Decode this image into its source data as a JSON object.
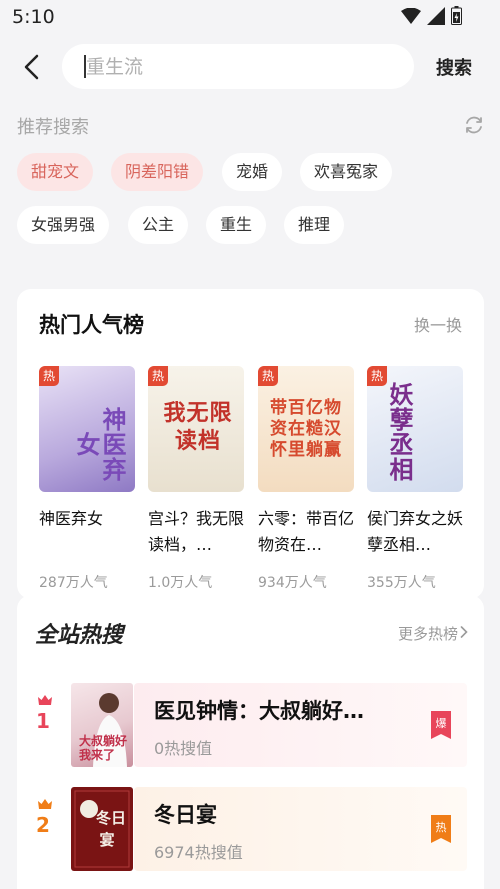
{
  "status": {
    "time": "5:10"
  },
  "search": {
    "placeholder": "重生流",
    "button": "搜索"
  },
  "recommend": {
    "title": "推荐搜索",
    "tags": [
      {
        "label": "甜宠文",
        "hot": true
      },
      {
        "label": "阴差阳错",
        "hot": true
      },
      {
        "label": "宠婚",
        "hot": false
      },
      {
        "label": "欢喜冤家",
        "hot": false
      },
      {
        "label": "女强男强",
        "hot": false
      },
      {
        "label": "公主",
        "hot": false
      },
      {
        "label": "重生",
        "hot": false
      },
      {
        "label": "推理",
        "hot": false
      }
    ]
  },
  "hot_rank": {
    "title": "热门人气榜",
    "swap": "换一换",
    "badge": "热",
    "books": [
      {
        "name": "神医弃女",
        "popularity": "287万人气",
        "cover_text": "神医弃女",
        "cover_color": "#cfc4e8"
      },
      {
        "name": "宫斗？我无限读档，…",
        "popularity": "1.0万人气",
        "cover_text": "我无限读档",
        "cover_color": "#f1ece2"
      },
      {
        "name": "六零：带百亿物资在…",
        "popularity": "934万人气",
        "cover_text": "带百亿物资在糙汉怀里躺赢",
        "cover_color": "#f7e9d6"
      },
      {
        "name": "侯门弃女之妖孽丞相…",
        "popularity": "355万人气",
        "cover_text": "妖孽丞相",
        "cover_color": "#dfe6f2"
      }
    ]
  },
  "site_hot": {
    "title": "全站热搜",
    "more": "更多热榜",
    "items": [
      {
        "rank": "1",
        "title": "医见钟情：大叔躺好…",
        "value": "0热搜值",
        "flag": "爆",
        "rank_color": "#e8455a",
        "flag_color": "#e8455a",
        "bg_color": "#fdf0f1"
      },
      {
        "rank": "2",
        "title": "冬日宴",
        "value": "6974热搜值",
        "flag": "热",
        "rank_color": "#f07d17",
        "flag_color": "#f07d17",
        "bg_color": "#fdf4ec"
      }
    ]
  }
}
